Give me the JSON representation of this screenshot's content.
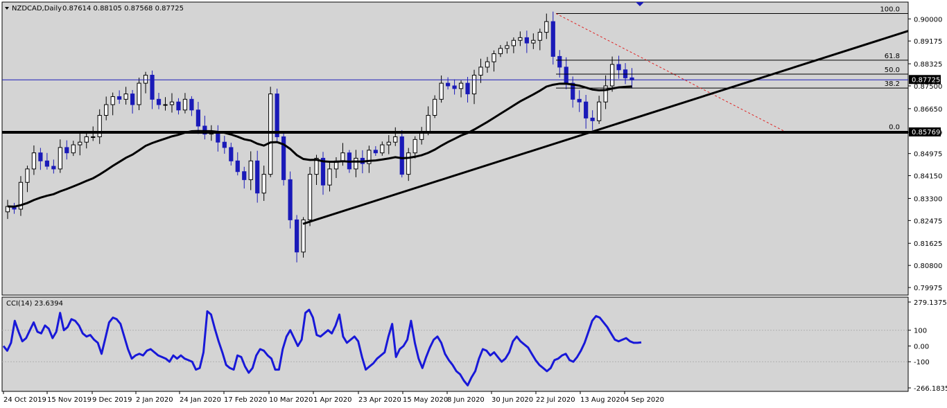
{
  "header": {
    "symbol": "NZDCAD,Daily",
    "ohlc": "0.87614 0.88105 0.87568 0.87725"
  },
  "indicator": {
    "label": "CCI(14) 23.6394"
  },
  "colors": {
    "background": "#d4d4d4",
    "candle_down": "#1a1ab8",
    "candle_up": "#000000",
    "cci": "#1818d8",
    "ma": "#000000",
    "support_line": "#000000",
    "fib_dashed": "#e02020",
    "price_line": "#1a1ab8"
  },
  "chart_data": [
    {
      "type": "candlestick",
      "title": "NZDCAD,Daily",
      "price_axis": {
        "ylim": [
          0.7977,
          0.9055
        ],
        "ticks": [
          "0.90000",
          "0.89175",
          "0.88325",
          "0.87500",
          "0.86650",
          "0.85769",
          "0.84975",
          "0.84150",
          "0.83300",
          "0.82475",
          "0.81625",
          "0.80800",
          "0.79975"
        ],
        "current_price": "0.87725"
      },
      "date_axis": [
        "24 Oct 2019",
        "15 Nov 2019",
        "9 Dec 2019",
        "2 Jan 2020",
        "24 Jan 2020",
        "17 Feb 2020",
        "10 Mar 2020",
        "1 Apr 2020",
        "23 Apr 2020",
        "15 May 2020",
        "8 Jun 2020",
        "30 Jun 2020",
        "22 Jul 2020",
        "13 Aug 2020",
        "4 Sep 2020"
      ],
      "closes": [
        0.83,
        0.829,
        0.839,
        0.844,
        0.85,
        0.847,
        0.845,
        0.844,
        0.852,
        0.85,
        0.853,
        0.854,
        0.856,
        0.856,
        0.864,
        0.868,
        0.871,
        0.87,
        0.872,
        0.868,
        0.876,
        0.879,
        0.87,
        0.868,
        0.868,
        0.869,
        0.866,
        0.87,
        0.866,
        0.86,
        0.857,
        0.858,
        0.854,
        0.852,
        0.847,
        0.843,
        0.84,
        0.847,
        0.835,
        0.842,
        0.872,
        0.856,
        0.84,
        0.825,
        0.813,
        0.825,
        0.842,
        0.848,
        0.838,
        0.844,
        0.847,
        0.85,
        0.844,
        0.848,
        0.846,
        0.851,
        0.85,
        0.853,
        0.854,
        0.856,
        0.842,
        0.85,
        0.855,
        0.858,
        0.864,
        0.87,
        0.876,
        0.875,
        0.874,
        0.876,
        0.872,
        0.879,
        0.882,
        0.884,
        0.887,
        0.889,
        0.89,
        0.892,
        0.893,
        0.891,
        0.892,
        0.895,
        0.899,
        0.886,
        0.882,
        0.876,
        0.87,
        0.869,
        0.863,
        0.862,
        0.869,
        0.875,
        0.883,
        0.881,
        0.878,
        0.8772
      ],
      "moving_average": {
        "period": 200
      },
      "fibonacci": {
        "levels": [
          "100.0",
          "61.8",
          "50.0",
          "38.2",
          "0.0"
        ],
        "prices": [
          0.902,
          0.8846,
          0.8794,
          0.8742,
          0.858
        ]
      },
      "horizontal_support": 0.85769,
      "trendline": {
        "from": [
          "1 Apr 2020",
          0.8235
        ],
        "to": [
          "4 Sep 2020+",
          0.898
        ]
      }
    },
    {
      "type": "line",
      "title": "CCI(14) 23.6394",
      "ylim": [
        -266.1835,
        279.1375
      ],
      "ticks": [
        "279.1375",
        "100",
        "0.00",
        "-100",
        "-266.1835"
      ],
      "series": [
        {
          "values": [
            0,
            -30,
            20,
            160,
            90,
            30,
            50,
            100,
            150,
            90,
            80,
            130,
            110,
            50,
            90,
            210,
            100,
            120,
            170,
            160,
            130,
            80,
            60,
            70,
            40,
            20,
            -50,
            50,
            150,
            180,
            170,
            140,
            60,
            -20,
            -80,
            -60,
            -50,
            -60,
            -30,
            -20,
            -40,
            -60,
            -70,
            -80,
            -100,
            -60,
            -80,
            -60,
            -80,
            -90,
            -100,
            -150,
            -140,
            -40,
            220,
            200,
            110,
            30,
            -40,
            -120,
            -140,
            -150,
            -60,
            -70,
            -130,
            -170,
            -140,
            -60,
            -20,
            -30,
            -60,
            -80,
            -150,
            -150,
            -20,
            60,
            100,
            50,
            0,
            40,
            210,
            230,
            180,
            70,
            60,
            80,
            100,
            80,
            130,
            200,
            60,
            20,
            40,
            60,
            30,
            -70,
            -150,
            -130,
            -110,
            -80,
            -60,
            -40,
            60,
            140,
            -70,
            -20,
            0,
            40,
            160,
            20,
            -80,
            -140,
            -70,
            -10,
            40,
            60,
            20,
            -50,
            -90,
            -120,
            -160,
            -180,
            -220,
            -250,
            -200,
            -160,
            -80,
            -20,
            -30,
            -60,
            -40,
            -70,
            -100,
            -80,
            -40,
            30,
            60,
            30,
            10,
            -10,
            -50,
            -90,
            -120,
            -140,
            -160,
            -140,
            -90,
            -80,
            -60,
            -50,
            -90,
            -100,
            -70,
            -30,
            20,
            90,
            160,
            190,
            180,
            150,
            120,
            80,
            40,
            30,
            40,
            50,
            30,
            20,
            20,
            23
          ]
        }
      ]
    }
  ]
}
